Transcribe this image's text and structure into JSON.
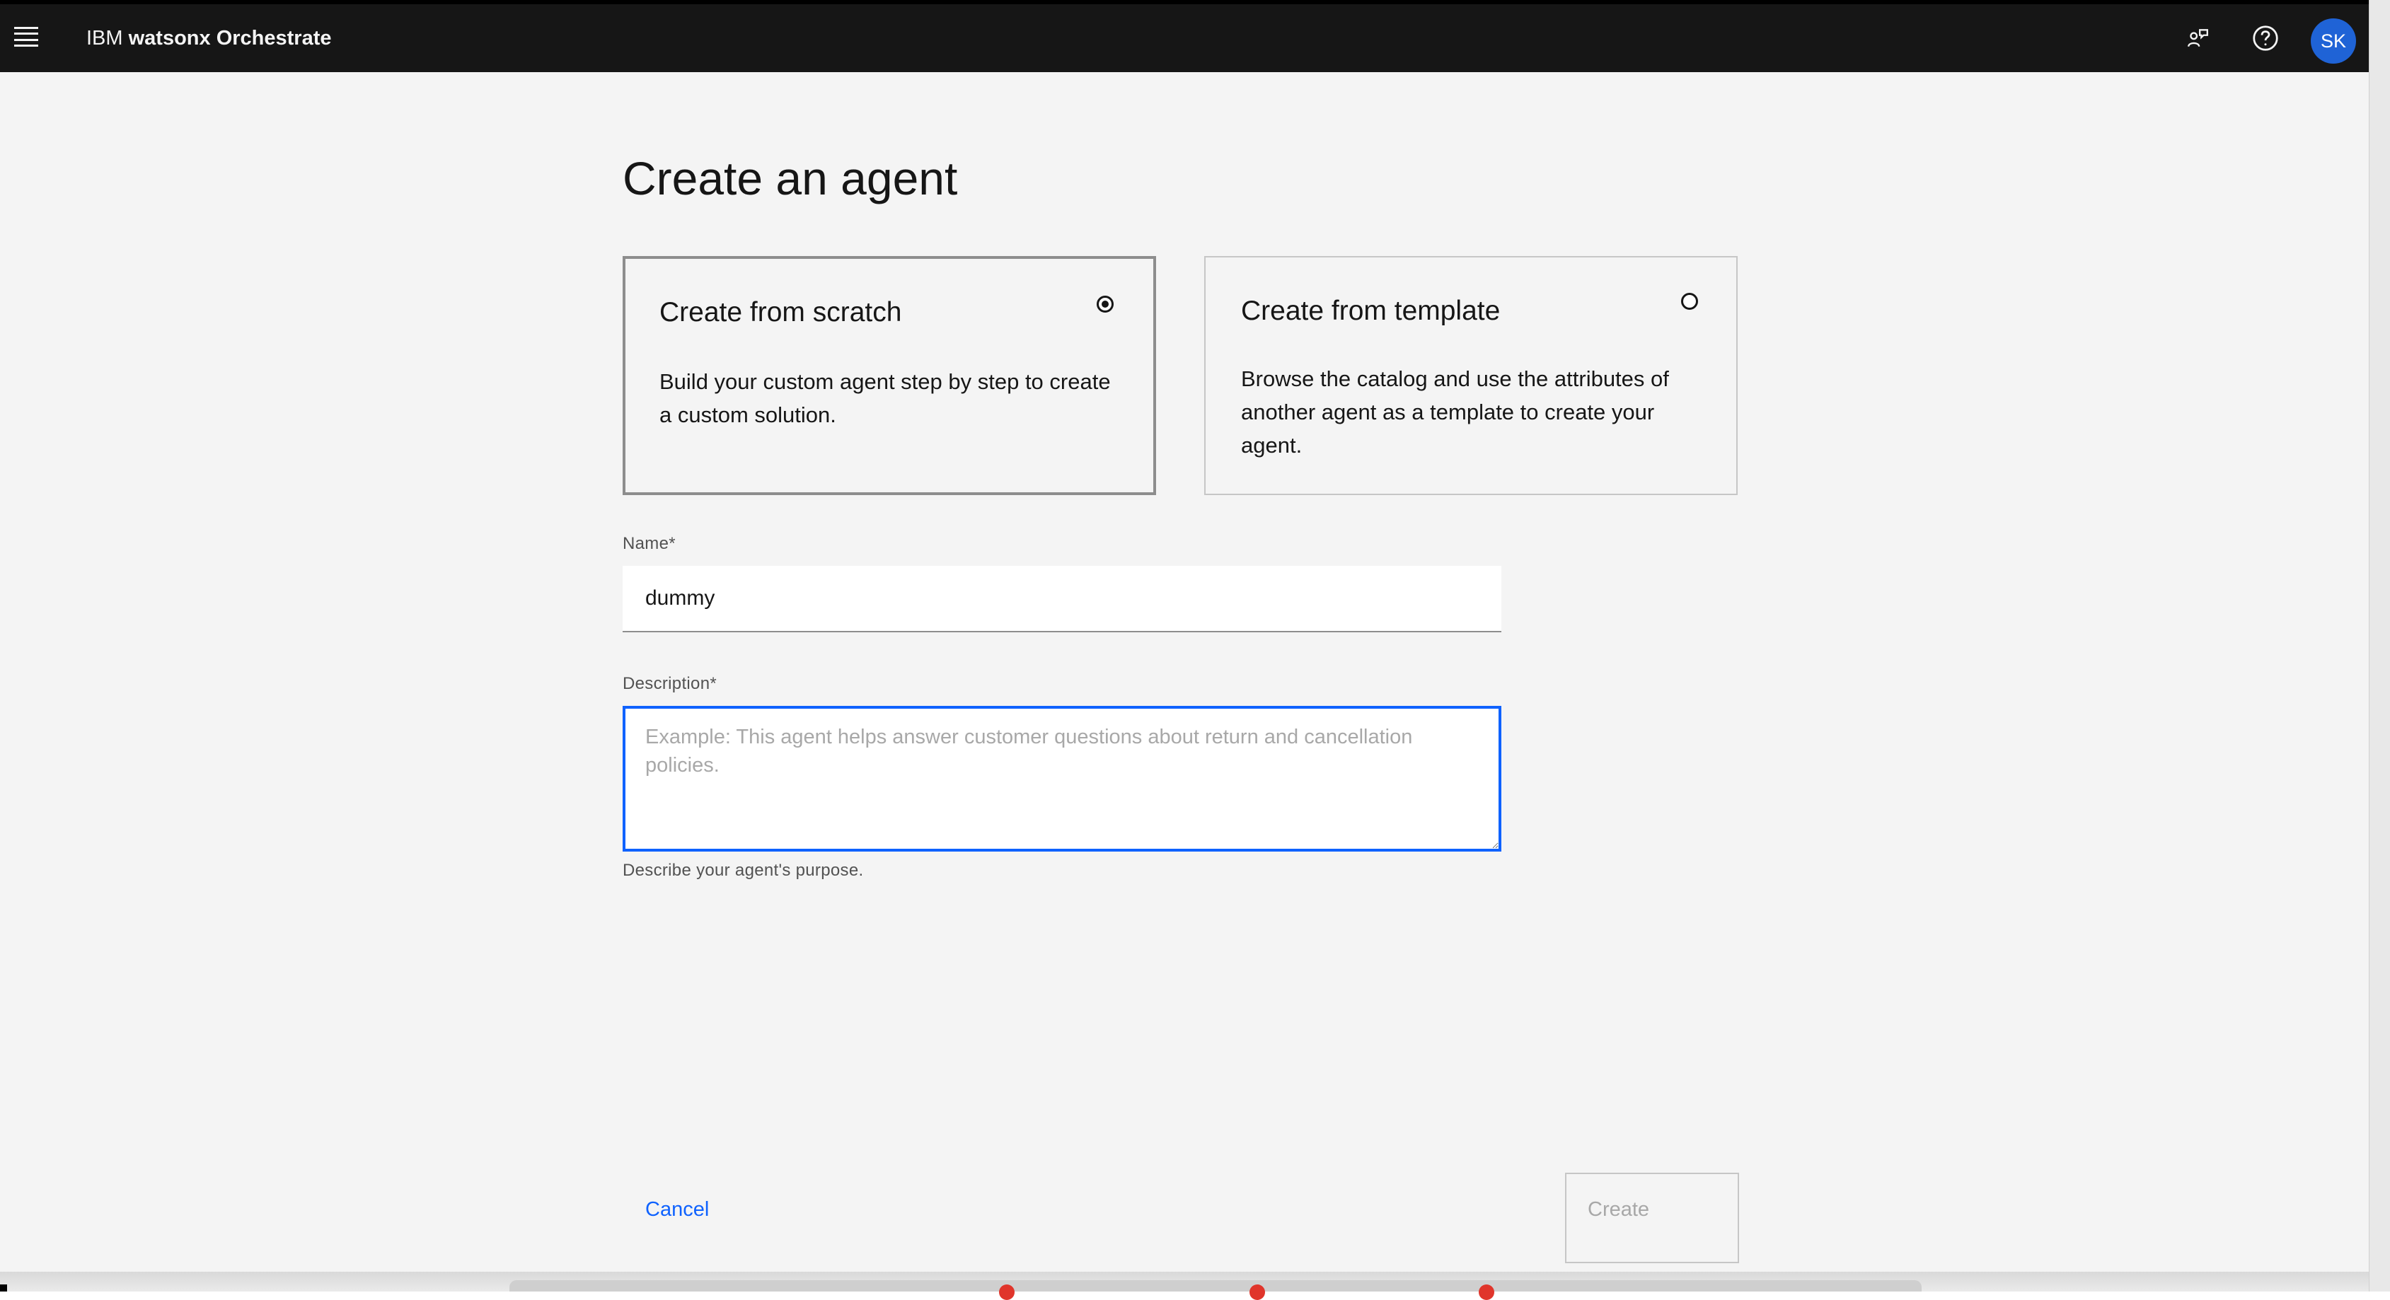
{
  "header": {
    "brand_prefix": "IBM",
    "product_name": "watsonx Orchestrate",
    "avatar_initials": "SK",
    "icons": {
      "menu": "hamburger-menu-icon",
      "feedback": "user-feedback-icon",
      "help": "help-icon"
    }
  },
  "page": {
    "title": "Create an agent"
  },
  "options": [
    {
      "title": "Create from scratch",
      "description": "Build your custom agent step by step to create a custom solution.",
      "selected": true
    },
    {
      "title": "Create from template",
      "description": "Browse the catalog and use the attributes of another agent as a template to create your agent.",
      "selected": false
    }
  ],
  "form": {
    "name": {
      "label": "Name*",
      "value": "dummy"
    },
    "description": {
      "label": "Description*",
      "placeholder": "Example: This agent helps answer customer questions about return and cancellation policies.",
      "value": "",
      "helper": "Describe your agent's purpose."
    }
  },
  "actions": {
    "cancel_label": "Cancel",
    "create_label": "Create",
    "create_enabled": false
  },
  "colors": {
    "header_bg": "#161616",
    "page_bg": "#f4f4f4",
    "accent": "#0f62fe",
    "avatar": "#1f63d6",
    "disabled_text": "#a8a8a8"
  }
}
